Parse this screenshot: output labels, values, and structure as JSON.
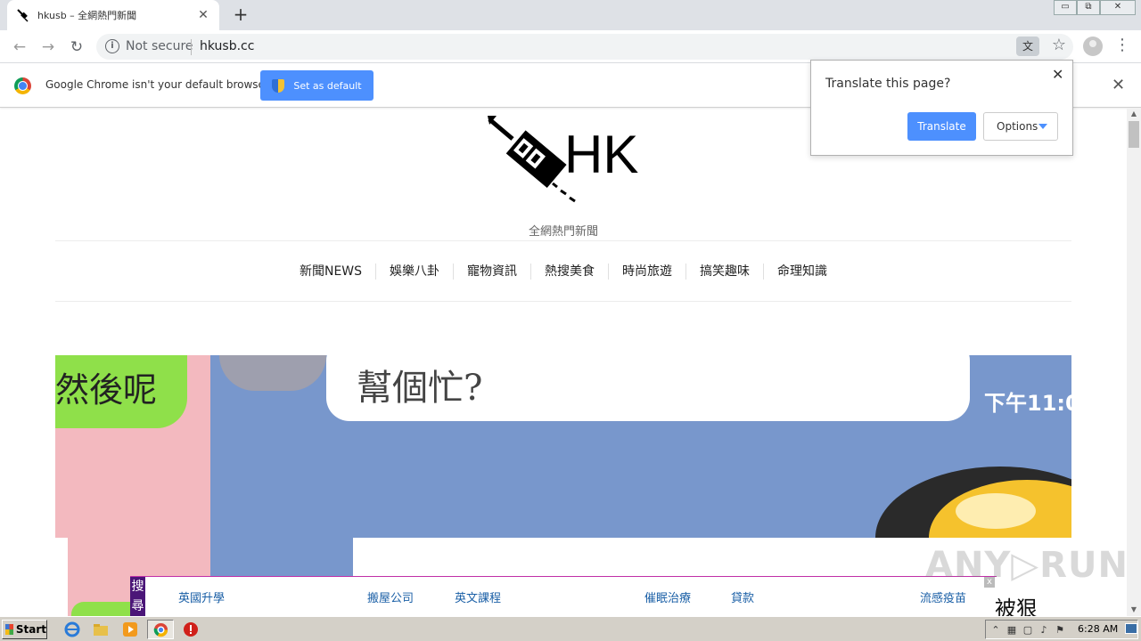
{
  "browser": {
    "tab_title": "hkusb – 全網熱門新聞",
    "tab_close": "✕",
    "new_tab": "+",
    "window_buttons": [
      "▭",
      "⧉",
      "✕"
    ]
  },
  "omnibox": {
    "security_label": "Not secure",
    "url": "hkusb.cc"
  },
  "infobar": {
    "message": "Google Chrome isn't your default browser",
    "set_default_label": "Set as default",
    "close": "✕"
  },
  "translate_popup": {
    "question": "Translate this page?",
    "translate_label": "Translate",
    "options_label": "Options",
    "close": "✕"
  },
  "site": {
    "logo_text": "HK",
    "tagline": "全網熱門新聞",
    "nav": [
      "新聞NEWS",
      "娛樂八卦",
      "寵物資訊",
      "熱搜美食",
      "時尚旅遊",
      "搞笑趣味",
      "命理知識"
    ]
  },
  "hero": {
    "left_text": "然後呢",
    "bubble_text": "幫個忙?",
    "time_text": "下午11:0"
  },
  "adbar": {
    "search_label": "搜尋",
    "links": [
      "英國升學",
      "搬屋公司",
      "英文課程",
      "催眠治療",
      "貸款",
      "流感疫苗"
    ],
    "close": "x"
  },
  "corner_text": "被狠",
  "watermark": "ANY▷RUN",
  "taskbar": {
    "start_label": "Start",
    "clock": "6:28 AM"
  },
  "colors": {
    "accent_blue": "#4d90fe",
    "hero_blue": "#7897cc",
    "hero_pink": "#f3b9bf",
    "hero_green": "#8fe04a",
    "adbar_purple": "#4b1678"
  }
}
